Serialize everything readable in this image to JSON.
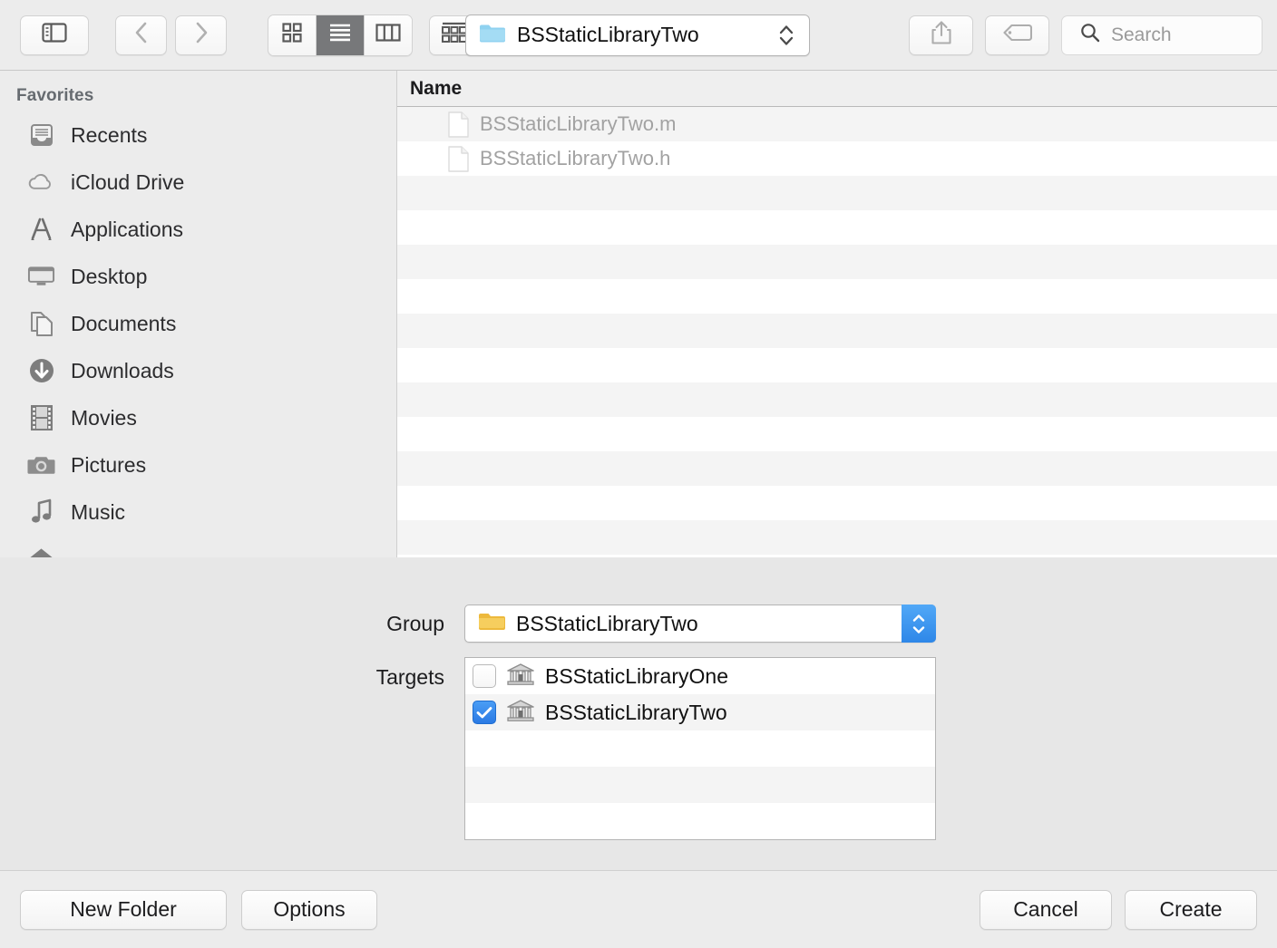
{
  "toolbar": {
    "sidebar_toggle_icon": "sidebar-toggle-icon",
    "back_icon": "chevron-left-icon",
    "forward_icon": "chevron-right-icon",
    "view_icon_grid": "icon-view-icon",
    "view_list": "list-view-icon",
    "view_columns": "column-view-icon",
    "arrange_icon": "arrange-by-icon",
    "arrange_chevron": "chevron-down-icon",
    "share_icon": "share-icon",
    "tag_icon": "tag-icon",
    "search_icon": "search-icon",
    "search_placeholder": "Search",
    "search_value": "",
    "path_popup_label": "BSStaticLibraryTwo",
    "path_popup_icon": "blue-folder-icon",
    "path_popup_stepper": "up-down-stepper-icon",
    "selected_view": "list"
  },
  "sidebar": {
    "header": "Favorites",
    "items": [
      {
        "label": "Recents",
        "icon": "recents-tray-icon"
      },
      {
        "label": "iCloud Drive",
        "icon": "cloud-icon"
      },
      {
        "label": "Applications",
        "icon": "applications-icon"
      },
      {
        "label": "Desktop",
        "icon": "desktop-icon"
      },
      {
        "label": "Documents",
        "icon": "documents-icon"
      },
      {
        "label": "Downloads",
        "icon": "downloads-icon"
      },
      {
        "label": "Movies",
        "icon": "movies-film-icon"
      },
      {
        "label": "Pictures",
        "icon": "pictures-camera-icon"
      },
      {
        "label": "Music",
        "icon": "music-note-icon"
      },
      {
        "label": "",
        "icon": "home-icon"
      }
    ]
  },
  "filelist": {
    "column_header": "Name",
    "rows": [
      {
        "name": "BSStaticLibraryTwo.m",
        "icon": "document-icon"
      },
      {
        "name": "BSStaticLibraryTwo.h",
        "icon": "document-icon"
      },
      {
        "name": "",
        "icon": ""
      },
      {
        "name": "",
        "icon": ""
      },
      {
        "name": "",
        "icon": ""
      },
      {
        "name": "",
        "icon": ""
      },
      {
        "name": "",
        "icon": ""
      },
      {
        "name": "",
        "icon": ""
      },
      {
        "name": "",
        "icon": ""
      },
      {
        "name": "",
        "icon": ""
      },
      {
        "name": "",
        "icon": ""
      },
      {
        "name": "",
        "icon": ""
      },
      {
        "name": "",
        "icon": ""
      }
    ]
  },
  "accessory": {
    "group_label": "Group",
    "group_value": "BSStaticLibraryTwo",
    "group_icon": "yellow-folder-icon",
    "targets_label": "Targets",
    "targets": [
      {
        "name": "BSStaticLibraryOne",
        "checked": false,
        "icon": "target-library-icon"
      },
      {
        "name": "BSStaticLibraryTwo",
        "checked": true,
        "icon": "target-library-icon"
      },
      {
        "name": "",
        "checked": null,
        "icon": ""
      },
      {
        "name": "",
        "checked": null,
        "icon": ""
      },
      {
        "name": "",
        "checked": null,
        "icon": ""
      }
    ]
  },
  "footer": {
    "new_folder_label": "New Folder",
    "options_label": "Options",
    "cancel_label": "Cancel",
    "create_label": "Create"
  },
  "colors": {
    "accent_blue": "#2b7ae4",
    "folder_yellow": "#f5c council",
    "window_bg": "#ececec"
  }
}
